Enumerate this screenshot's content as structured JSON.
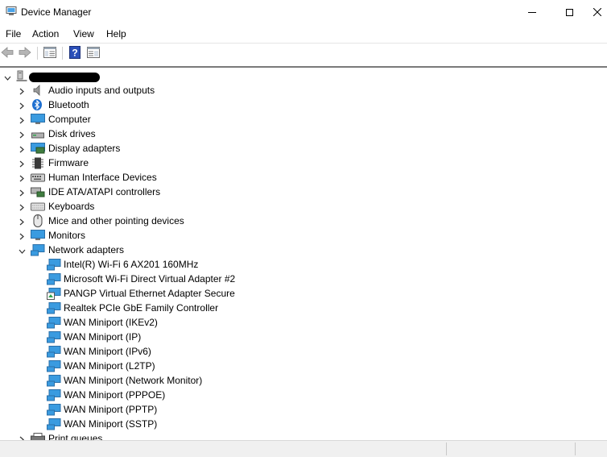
{
  "window": {
    "title": "Device Manager"
  },
  "menu": {
    "file": "File",
    "action": "Action",
    "view": "View",
    "help": "Help"
  },
  "toolbar": {
    "buttons": [
      "back-icon",
      "forward-icon",
      "properties-pane-icon",
      "help-icon",
      "view-toggle-icon"
    ]
  },
  "tree": {
    "root": {
      "label": "",
      "expanded": true
    },
    "categories": [
      {
        "label": "Audio inputs and outputs",
        "icon": "speaker-icon"
      },
      {
        "label": "Bluetooth",
        "icon": "bluetooth-icon"
      },
      {
        "label": "Computer",
        "icon": "computer-icon"
      },
      {
        "label": "Disk drives",
        "icon": "disk-drive-icon"
      },
      {
        "label": "Display adapters",
        "icon": "display-adapter-icon"
      },
      {
        "label": "Firmware",
        "icon": "firmware-chip-icon"
      },
      {
        "label": "Human Interface Devices",
        "icon": "hid-icon"
      },
      {
        "label": "IDE ATA/ATAPI controllers",
        "icon": "ide-controller-icon"
      },
      {
        "label": "Keyboards",
        "icon": "keyboard-icon"
      },
      {
        "label": "Mice and other pointing devices",
        "icon": "mouse-icon"
      },
      {
        "label": "Monitors",
        "icon": "monitor-icon"
      },
      {
        "label": "Network adapters",
        "icon": "network-adapter-icon",
        "expanded": true
      }
    ],
    "network_adapters": [
      "Intel(R) Wi-Fi 6 AX201 160MHz",
      "Microsoft Wi-Fi Direct Virtual Adapter #2",
      "PANGP Virtual Ethernet Adapter Secure",
      "Realtek PCIe GbE Family Controller",
      "WAN Miniport (IKEv2)",
      "WAN Miniport (IP)",
      "WAN Miniport (IPv6)",
      "WAN Miniport (L2TP)",
      "WAN Miniport (Network Monitor)",
      "WAN Miniport (PPPOE)",
      "WAN Miniport (PPTP)",
      "WAN Miniport (SSTP)"
    ],
    "after": [
      {
        "label": "Print queues",
        "icon": "printer-icon"
      }
    ]
  },
  "colors": {
    "accent": "#1e73c8",
    "network_icon": "#2b8fd6"
  }
}
